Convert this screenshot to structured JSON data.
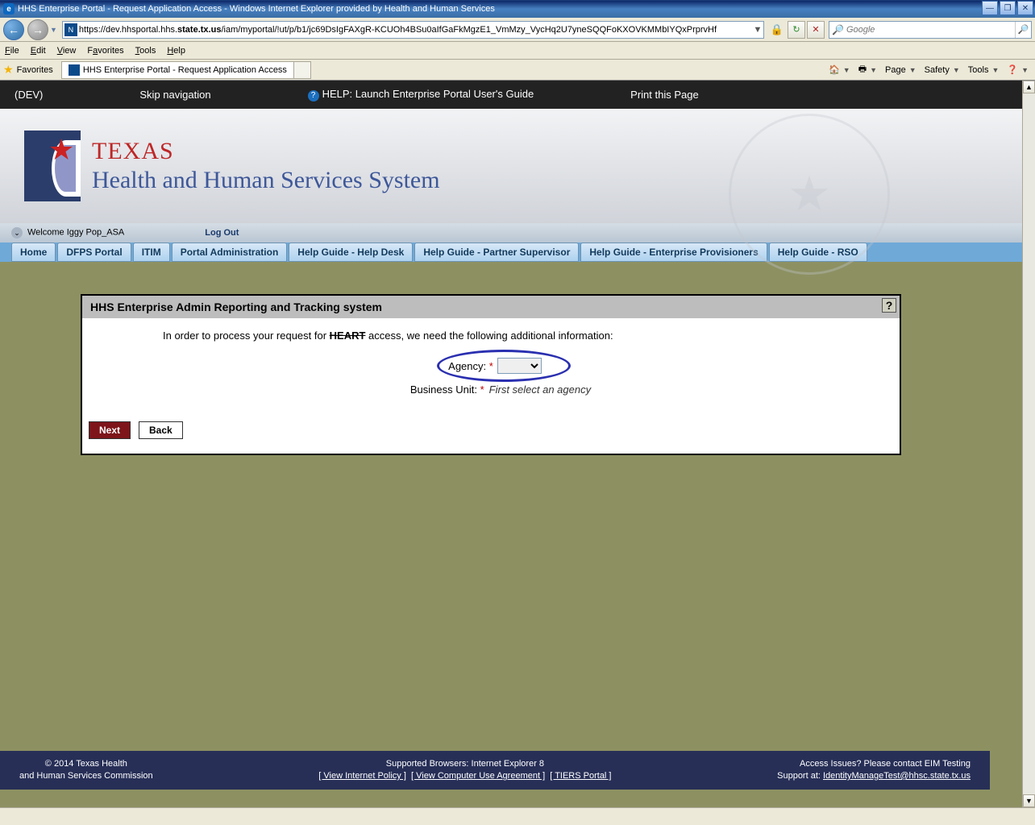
{
  "window": {
    "title": "HHS Enterprise Portal - Request Application Access - Windows Internet Explorer provided by Health and Human Services",
    "min": "—",
    "max": "❐",
    "close": "✕"
  },
  "address": {
    "scheme": "https",
    "prefix": "://dev.hhsportal.hhs.",
    "bold": "state.tx.us",
    "rest": "/iam/myportal/!ut/p/b1/jc69DsIgFAXgR-KCUOh4BSu0aIfGaFkMgzE1_VmMzy_VycHq2U7yneSQQFoKXOVKMMbIYQxPrprvHf",
    "lock": "🔒",
    "refresh": "↻",
    "stop": "✕"
  },
  "search": {
    "placeholder": "Google",
    "mag": "🔎"
  },
  "menu": {
    "file": "File",
    "edit": "Edit",
    "view": "View",
    "favorites": "Favorites",
    "tools": "Tools",
    "help": "Help"
  },
  "fav": {
    "label": "Favorites",
    "tab": "HHS Enterprise Portal - Request Application Access"
  },
  "toolbar": {
    "home": "🏠",
    "print": "🖶",
    "page": "Page",
    "safety": "Safety",
    "tools": "Tools",
    "help": "❓"
  },
  "portal": {
    "dev": "(DEV)",
    "skip": "Skip navigation",
    "help": "HELP: Launch Enterprise Portal User's Guide",
    "print": "Print this Page"
  },
  "branding": {
    "line1": "TEXAS",
    "line2": "Health and Human Services System"
  },
  "userbar": {
    "welcome": "Welcome Iggy Pop_ASA",
    "logout": "Log Out"
  },
  "tabs": [
    "Home",
    "DFPS Portal",
    "ITIM",
    "Portal Administration",
    "Help Guide - Help Desk",
    "Help Guide - Partner Supervisor",
    "Help Guide - Enterprise Provisioners",
    "Help Guide - RSO"
  ],
  "panel": {
    "title": "HHS Enterprise Admin Reporting and Tracking system",
    "help": "?",
    "intro_pre": "In order to process your request for ",
    "intro_heart": "HEART",
    "intro_post": " access, we need the following additional information:",
    "agency_label": "Agency:",
    "bu_label": "Business Unit:",
    "bu_hint": "First select an agency",
    "next": "Next",
    "back": "Back"
  },
  "footer": {
    "copyright": "© 2014 Texas Health",
    "copyright2": "and Human Services Commission",
    "browsers": "Supported Browsers: Internet Explorer 8",
    "link1": "[ View Internet Policy ]",
    "link2": "[ View Computer Use Agreement ]",
    "link3": "[ TIERS Portal ]",
    "issues": "Access Issues? Please contact EIM Testing",
    "support_pre": "Support at: ",
    "support_email": "IdentityManageTest@hhsc.state.tx.us"
  }
}
